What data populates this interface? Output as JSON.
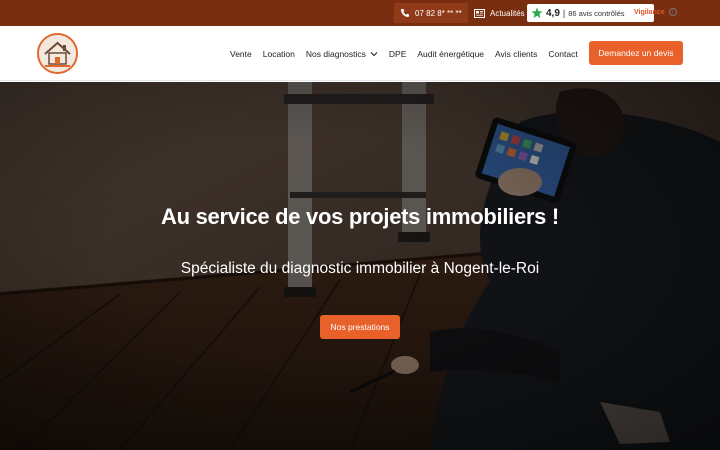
{
  "topbar": {
    "phone_icon": "phone-icon",
    "phone": "07 82 8* ** **",
    "news_icon": "newspaper-icon",
    "news_label": "Actualités",
    "reviews": {
      "star_icon": "star-icon",
      "score": "4,9",
      "separator": "|",
      "count": "86 avis contrôlés",
      "brand": "Vigilance",
      "info_icon": "info-icon"
    }
  },
  "header": {
    "logo_icon": "house-logo-icon",
    "nav": [
      {
        "label": "Vente"
      },
      {
        "label": "Location"
      },
      {
        "label": "Nos diagnostics",
        "icon": "chevron-down-icon"
      },
      {
        "label": "DPE"
      },
      {
        "label": "Audit énergétique"
      },
      {
        "label": "Avis clients"
      },
      {
        "label": "Contact"
      }
    ],
    "cta_label": "Demandez un devis"
  },
  "hero": {
    "title": "Au service de vos projets immobiliers !",
    "subtitle": "Spécialiste du diagnostic immobilier à Nogent-le-Roi",
    "button_label": "Nos prestations"
  },
  "colors": {
    "topbar_bg": "#7a2e10",
    "accent": "#e8602a",
    "review_green": "#2fa84f"
  }
}
